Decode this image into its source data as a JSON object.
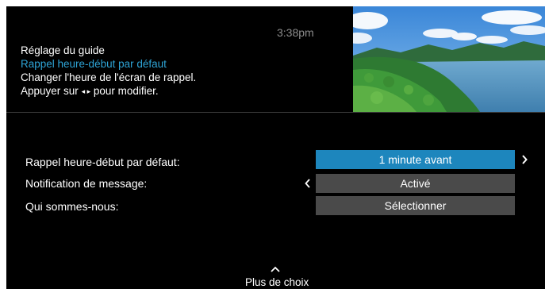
{
  "header": {
    "time": "3:38pm",
    "title": "Réglage du guide",
    "subtitle": "Rappel heure-début par défaut",
    "description": "Changer l'heure de l'écran de rappel.",
    "hint_prefix": "Appuyer sur",
    "hint_arrows": "◂ ▸",
    "hint_suffix": "pour modifier."
  },
  "settings": [
    {
      "label": "Rappel heure-début par défaut:",
      "value": "1 minute avant",
      "selected": true
    },
    {
      "label": "Notification de message:",
      "value": "Activé",
      "selected": false
    },
    {
      "label": "Qui sommes-nous:",
      "value": "Sélectionner",
      "selected": false
    }
  ],
  "footer": {
    "more_label": "Plus de choix"
  },
  "icons": {
    "right": "chevron-right-icon",
    "left": "chevron-left-icon",
    "up": "chevron-up-icon"
  },
  "colors": {
    "accent": "#2ea4d6",
    "selected_bg": "#1d86bd",
    "option_bg": "#4a4a4a",
    "time": "#8d8d8d"
  }
}
